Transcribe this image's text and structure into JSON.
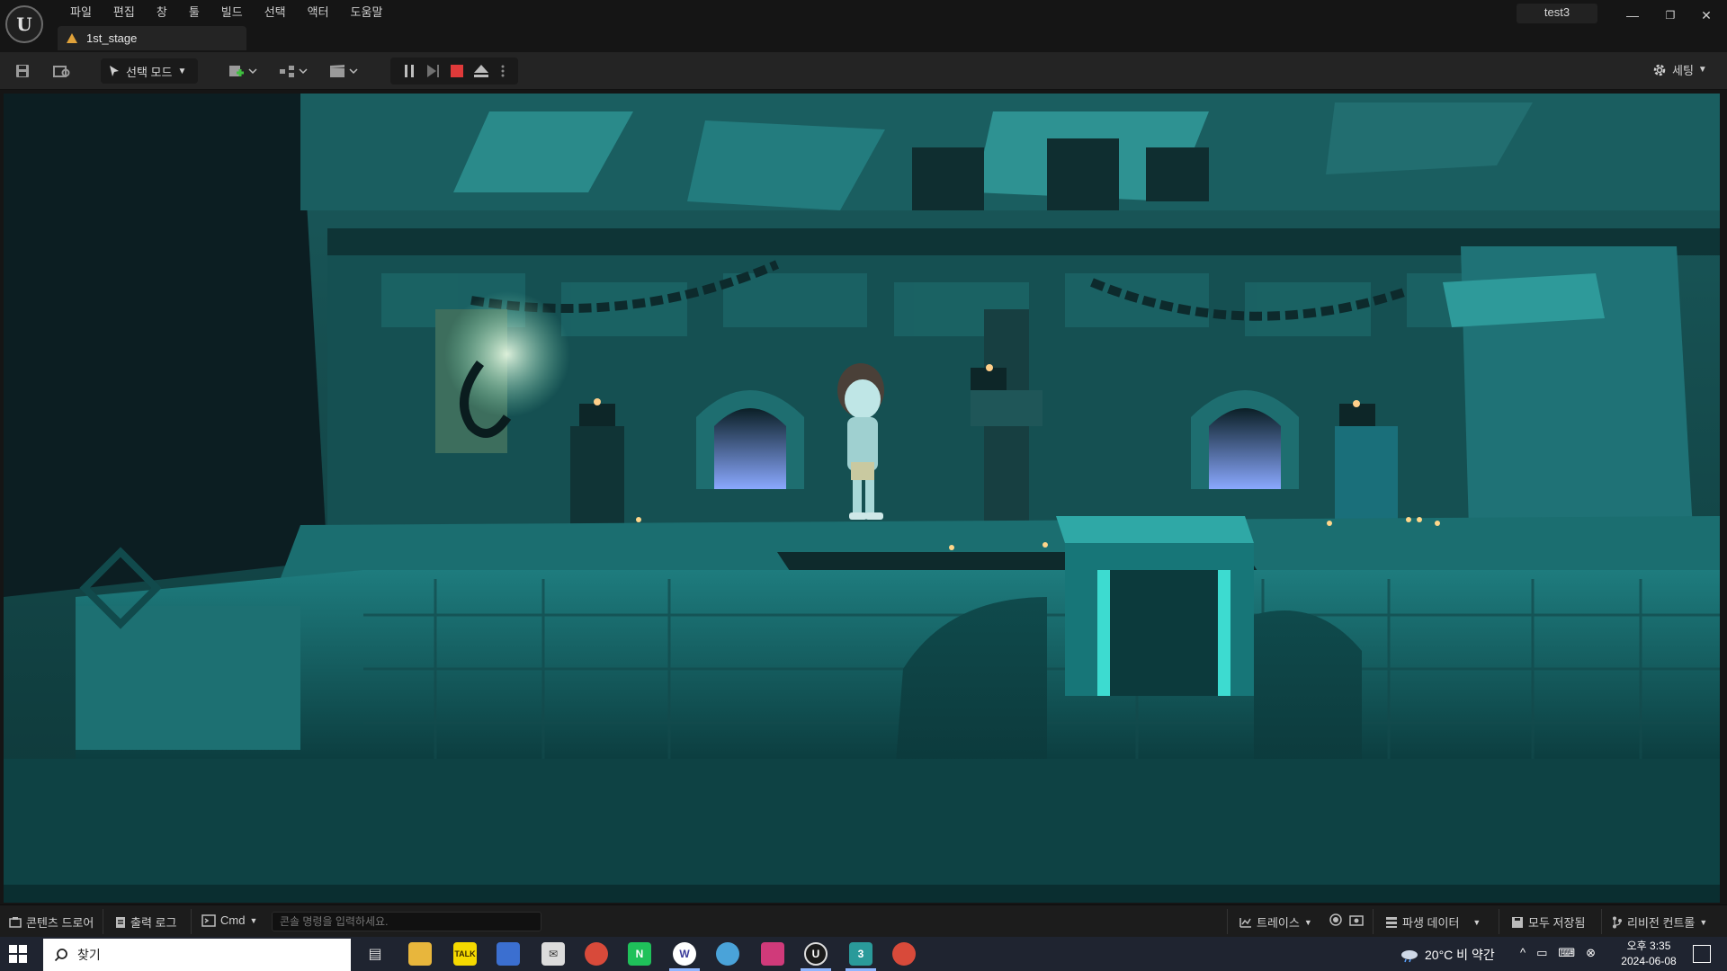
{
  "menu": [
    "파일",
    "편집",
    "창",
    "툴",
    "빌드",
    "선택",
    "액터",
    "도움말"
  ],
  "tab": {
    "label": "1st_stage"
  },
  "project_name": "test3",
  "window_controls": {
    "minimize": "—",
    "restore": "❐",
    "close": "✕"
  },
  "toolbar": {
    "mode_label": "선택 모드",
    "settings_label": "세팅"
  },
  "statusbar": {
    "content_drawer": "콘텐츠 드로어",
    "output_log": "출력 로그",
    "cmd": "Cmd",
    "console_placeholder": "콘솔 명령을 입력하세요.",
    "trace": "트레이스",
    "derived_data": "파생 데이터",
    "save_all": "모두 저장됨",
    "revision_control": "리비전 컨트롤"
  },
  "taskbar": {
    "search_label": "찾기",
    "weather": "20°C  비 약간",
    "time": "오후 3:35",
    "date": "2024-06-08"
  },
  "colors": {
    "accent_blue": "#1e6fdc",
    "scene_teal": "#1f8c8c",
    "stop_red": "#e03a3a"
  }
}
